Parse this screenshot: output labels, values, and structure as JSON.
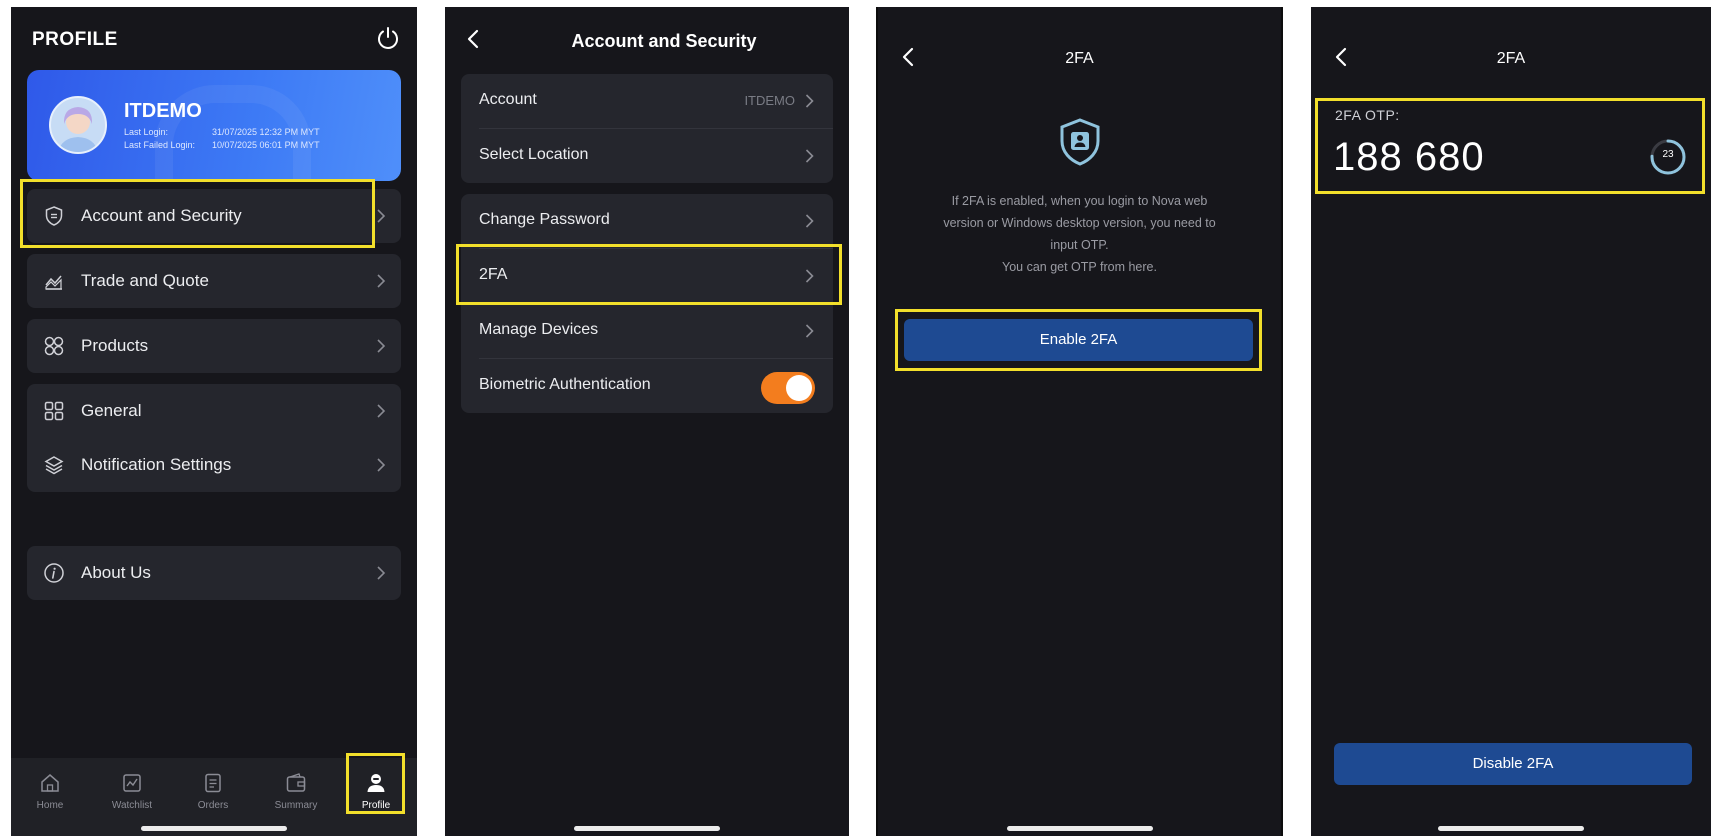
{
  "screen1": {
    "title": "PROFILE",
    "user": {
      "name": "ITDEMO",
      "last_login_label": "Last Login:",
      "last_login_value": "31/07/2025 12:32 PM MYT",
      "last_failed_label": "Last Failed Login:",
      "last_failed_value": "10/07/2025 06:01 PM MYT"
    },
    "menu": {
      "account_security": "Account and Security",
      "trade_quote": "Trade and Quote",
      "products": "Products",
      "general": "General",
      "notification_settings": "Notification Settings",
      "about_us": "About Us"
    },
    "tabs": {
      "home": "Home",
      "watchlist": "Watchlist",
      "orders": "Orders",
      "summary": "Summary",
      "profile": "Profile"
    }
  },
  "screen2": {
    "title": "Account and Security",
    "account_label": "Account",
    "account_value": "ITDEMO",
    "select_location": "Select Location",
    "change_password": "Change Password",
    "twofa": "2FA",
    "manage_devices": "Manage Devices",
    "biometric": "Biometric Authentication",
    "biometric_enabled": true
  },
  "screen3": {
    "title": "2FA",
    "info_line1": "If 2FA is enabled, when you login to Nova web",
    "info_line2": "version or Windows desktop version, you need to",
    "info_line3": "input OTP.",
    "info_line4": "You can get OTP from here.",
    "enable_button": "Enable 2FA"
  },
  "screen4": {
    "title": "2FA",
    "otp_label": "2FA OTP:",
    "otp_code": "188 680",
    "countdown": "23",
    "disable_button": "Disable 2FA"
  },
  "colors": {
    "background": "#16161b",
    "card": "#25262d",
    "highlight": "#f2df2b",
    "primary_button": "#1e4a92",
    "toggle_on": "#f37d1e",
    "profile_gradient_start": "#2f59e9"
  }
}
